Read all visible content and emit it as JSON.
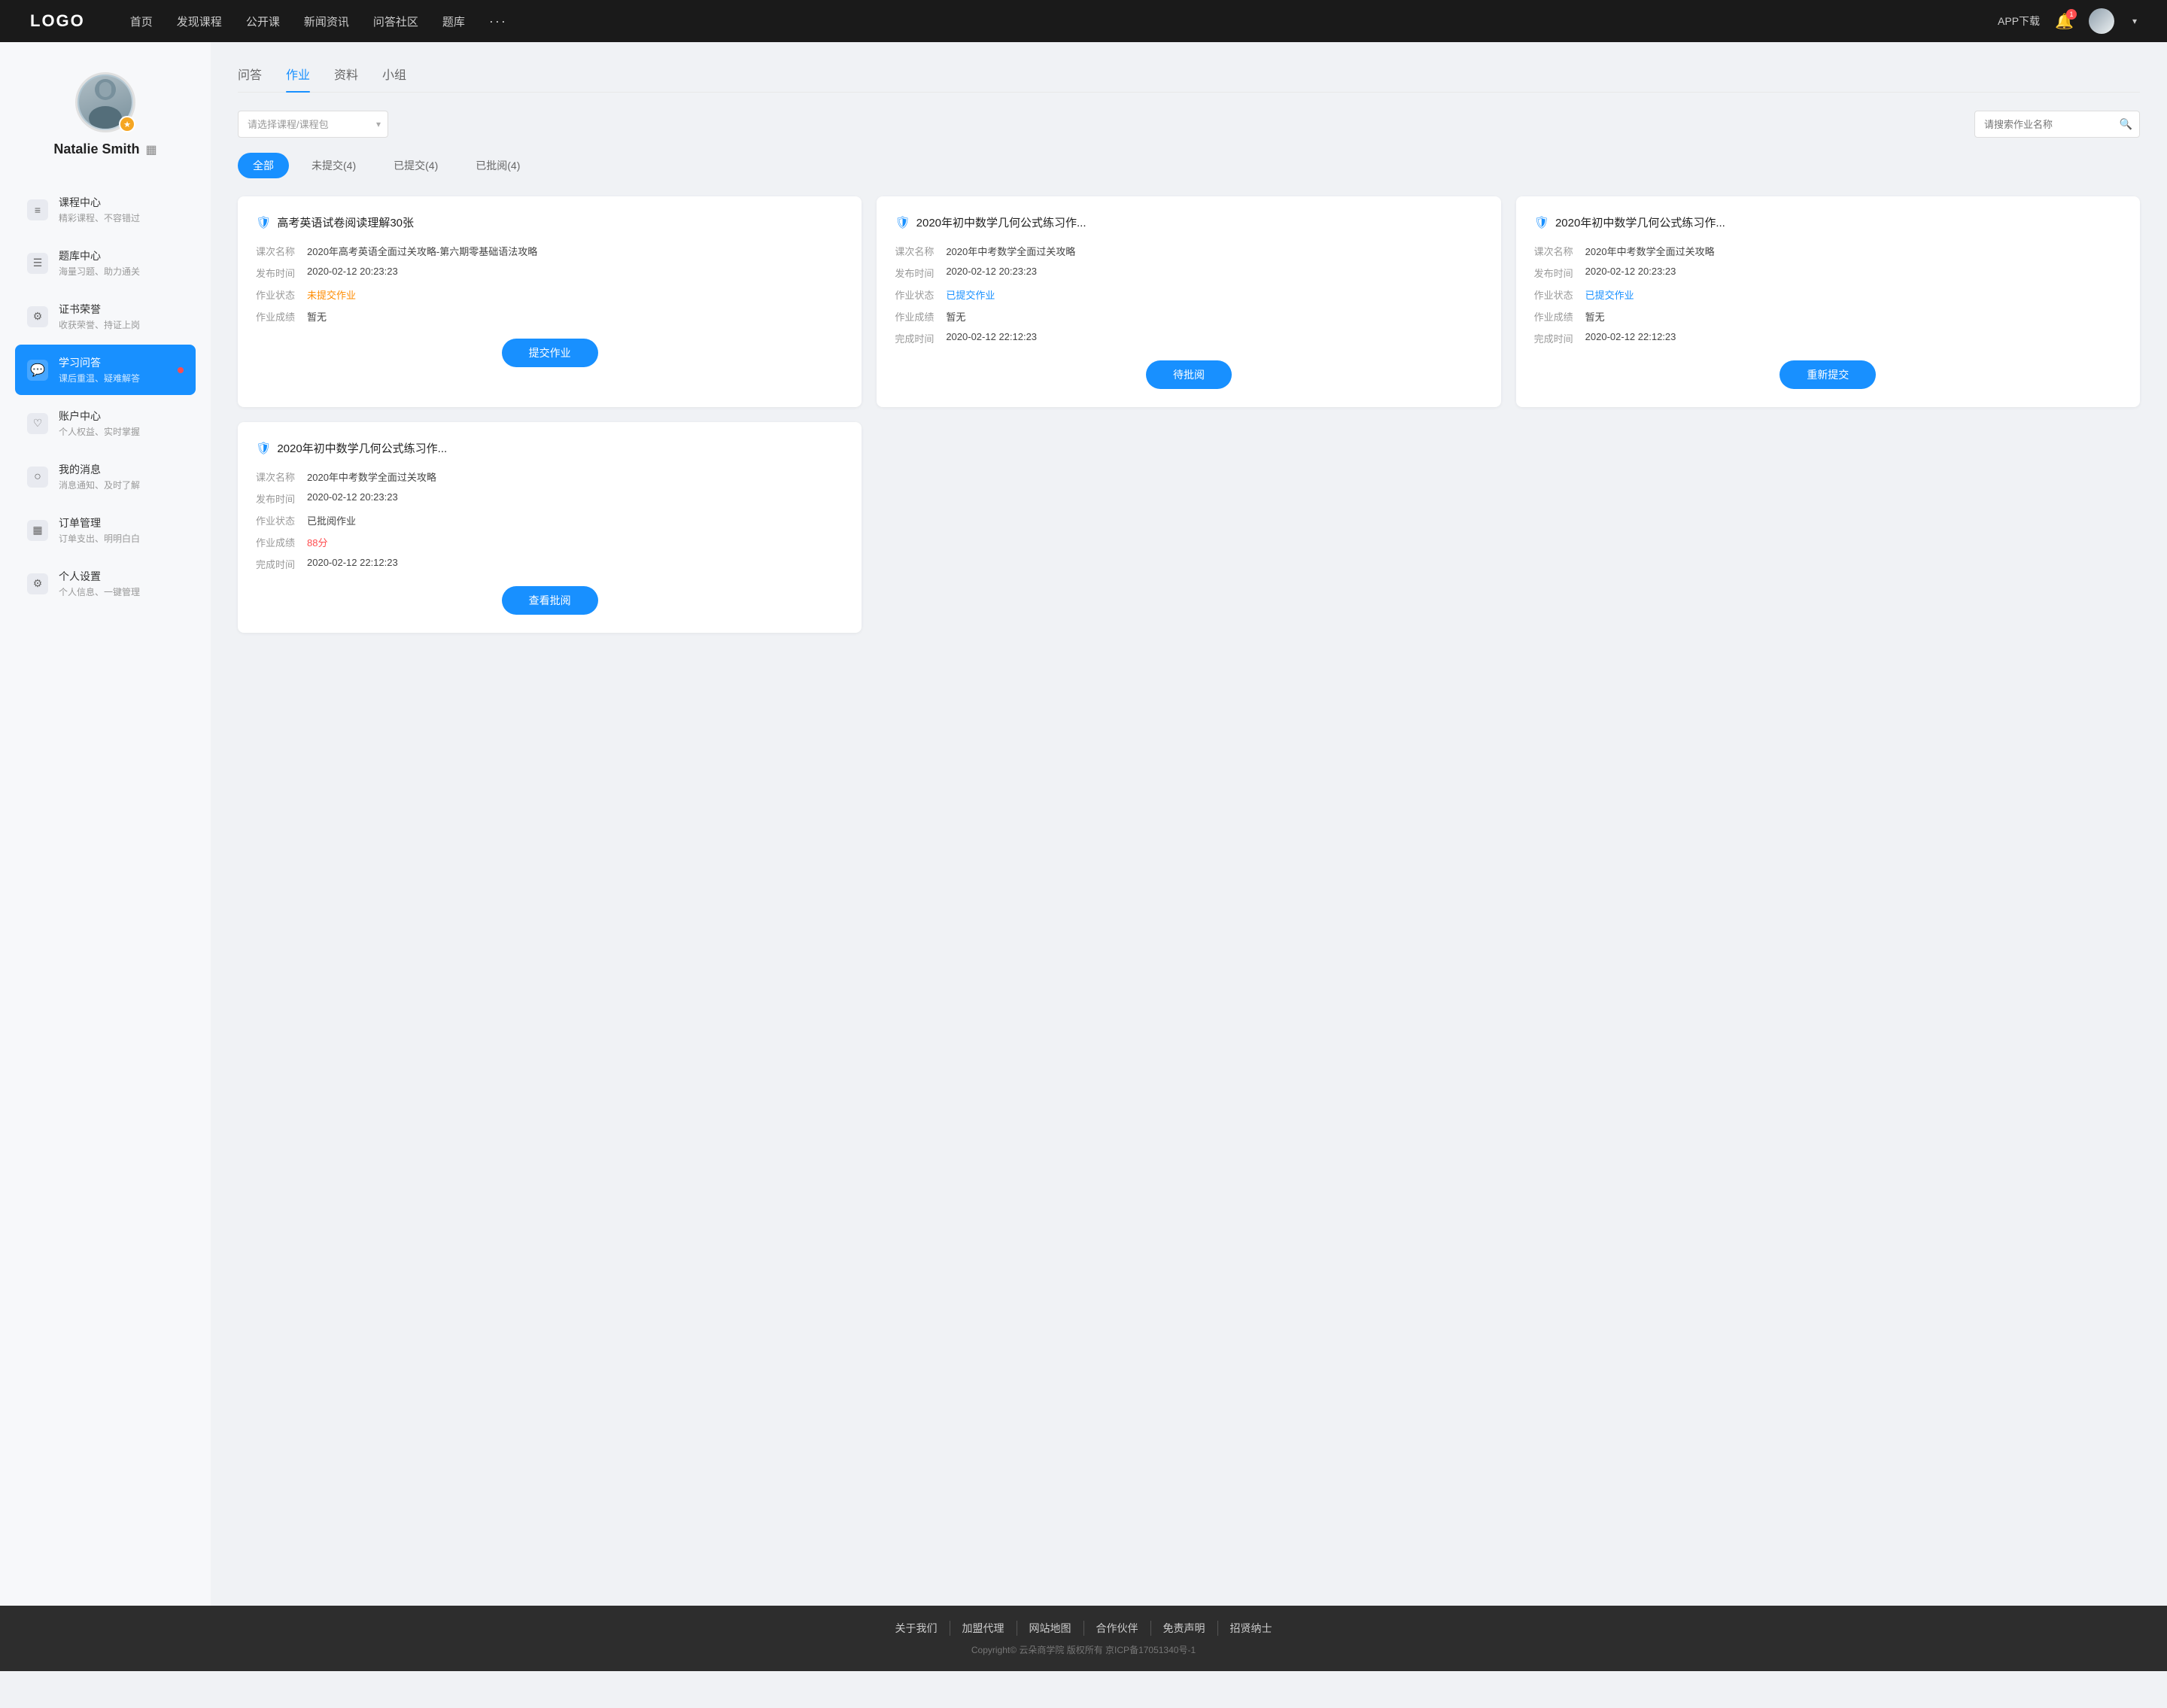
{
  "nav": {
    "logo": "LOGO",
    "links": [
      "首页",
      "发现课程",
      "公开课",
      "新闻资讯",
      "问答社区",
      "题库"
    ],
    "more": "···",
    "app_download": "APP下载",
    "bell_count": "1",
    "chevron": "▾"
  },
  "sidebar": {
    "user_name": "Natalie Smith",
    "items": [
      {
        "id": "course-center",
        "title": "课程中心",
        "sub": "精彩课程、不容错过",
        "icon": "≡"
      },
      {
        "id": "question-bank",
        "title": "题库中心",
        "sub": "海量习题、助力通关",
        "icon": "☰"
      },
      {
        "id": "certificate",
        "title": "证书荣誉",
        "sub": "收获荣誉、持证上岗",
        "icon": "⚙"
      },
      {
        "id": "study-qa",
        "title": "学习问答",
        "sub": "课后重温、疑难解答",
        "icon": "💬",
        "active": true,
        "dot": true
      },
      {
        "id": "account",
        "title": "账户中心",
        "sub": "个人权益、实时掌握",
        "icon": "♡"
      },
      {
        "id": "messages",
        "title": "我的消息",
        "sub": "消息通知、及时了解",
        "icon": "○"
      },
      {
        "id": "orders",
        "title": "订单管理",
        "sub": "订单支出、明明白白",
        "icon": "▦"
      },
      {
        "id": "settings",
        "title": "个人设置",
        "sub": "个人信息、一键管理",
        "icon": "⚙"
      }
    ]
  },
  "content": {
    "tabs": [
      "问答",
      "作业",
      "资料",
      "小组"
    ],
    "active_tab": "作业",
    "filter_placeholder": "请选择课程/课程包",
    "search_placeholder": "请搜索作业名称",
    "status_buttons": [
      {
        "label": "全部",
        "active": true
      },
      {
        "label": "未提交(4)",
        "active": false
      },
      {
        "label": "已提交(4)",
        "active": false
      },
      {
        "label": "已批阅(4)",
        "active": false
      }
    ],
    "homework_cards": [
      {
        "title": "高考英语试卷阅读理解30张",
        "course_name": "2020年高考英语全面过关攻略-第六期零基础语法攻略",
        "publish_time": "2020-02-12 20:23:23",
        "status_label": "未提交作业",
        "status_color": "orange",
        "score_label": "暂无",
        "complete_time": "",
        "btn_label": "提交作业",
        "show_btn": true
      },
      {
        "title": "2020年初中数学几何公式练习作...",
        "course_name": "2020年中考数学全面过关攻略",
        "publish_time": "2020-02-12 20:23:23",
        "status_label": "已提交作业",
        "status_color": "blue",
        "score_label": "暂无",
        "complete_time": "2020-02-12 22:12:23",
        "btn_label": "待批阅",
        "show_btn": true
      },
      {
        "title": "2020年初中数学几何公式练习作...",
        "course_name": "2020年中考数学全面过关攻略",
        "publish_time": "2020-02-12 20:23:23",
        "status_label": "已提交作业",
        "status_color": "blue",
        "score_label": "暂无",
        "complete_time": "2020-02-12 22:12:23",
        "btn_label": "重新提交",
        "show_btn": true
      },
      {
        "title": "2020年初中数学几何公式练习作...",
        "course_name": "2020年中考数学全面过关攻略",
        "publish_time": "2020-02-12 20:23:23",
        "status_label": "已批阅作业",
        "status_color": "default",
        "score_label": "88分",
        "score_color": "score",
        "complete_time": "2020-02-12 22:12:23",
        "btn_label": "查看批阅",
        "show_btn": true
      }
    ],
    "labels": {
      "course_name": "课次名称",
      "publish_time": "发布时间",
      "status": "作业状态",
      "score": "作业成绩",
      "complete_time": "完成时间"
    }
  },
  "footer": {
    "links": [
      "关于我们",
      "加盟代理",
      "网站地图",
      "合作伙伴",
      "免责声明",
      "招贤纳士"
    ],
    "copyright": "Copyright© 云朵商学院 版权所有   京ICP备17051340号-1"
  }
}
